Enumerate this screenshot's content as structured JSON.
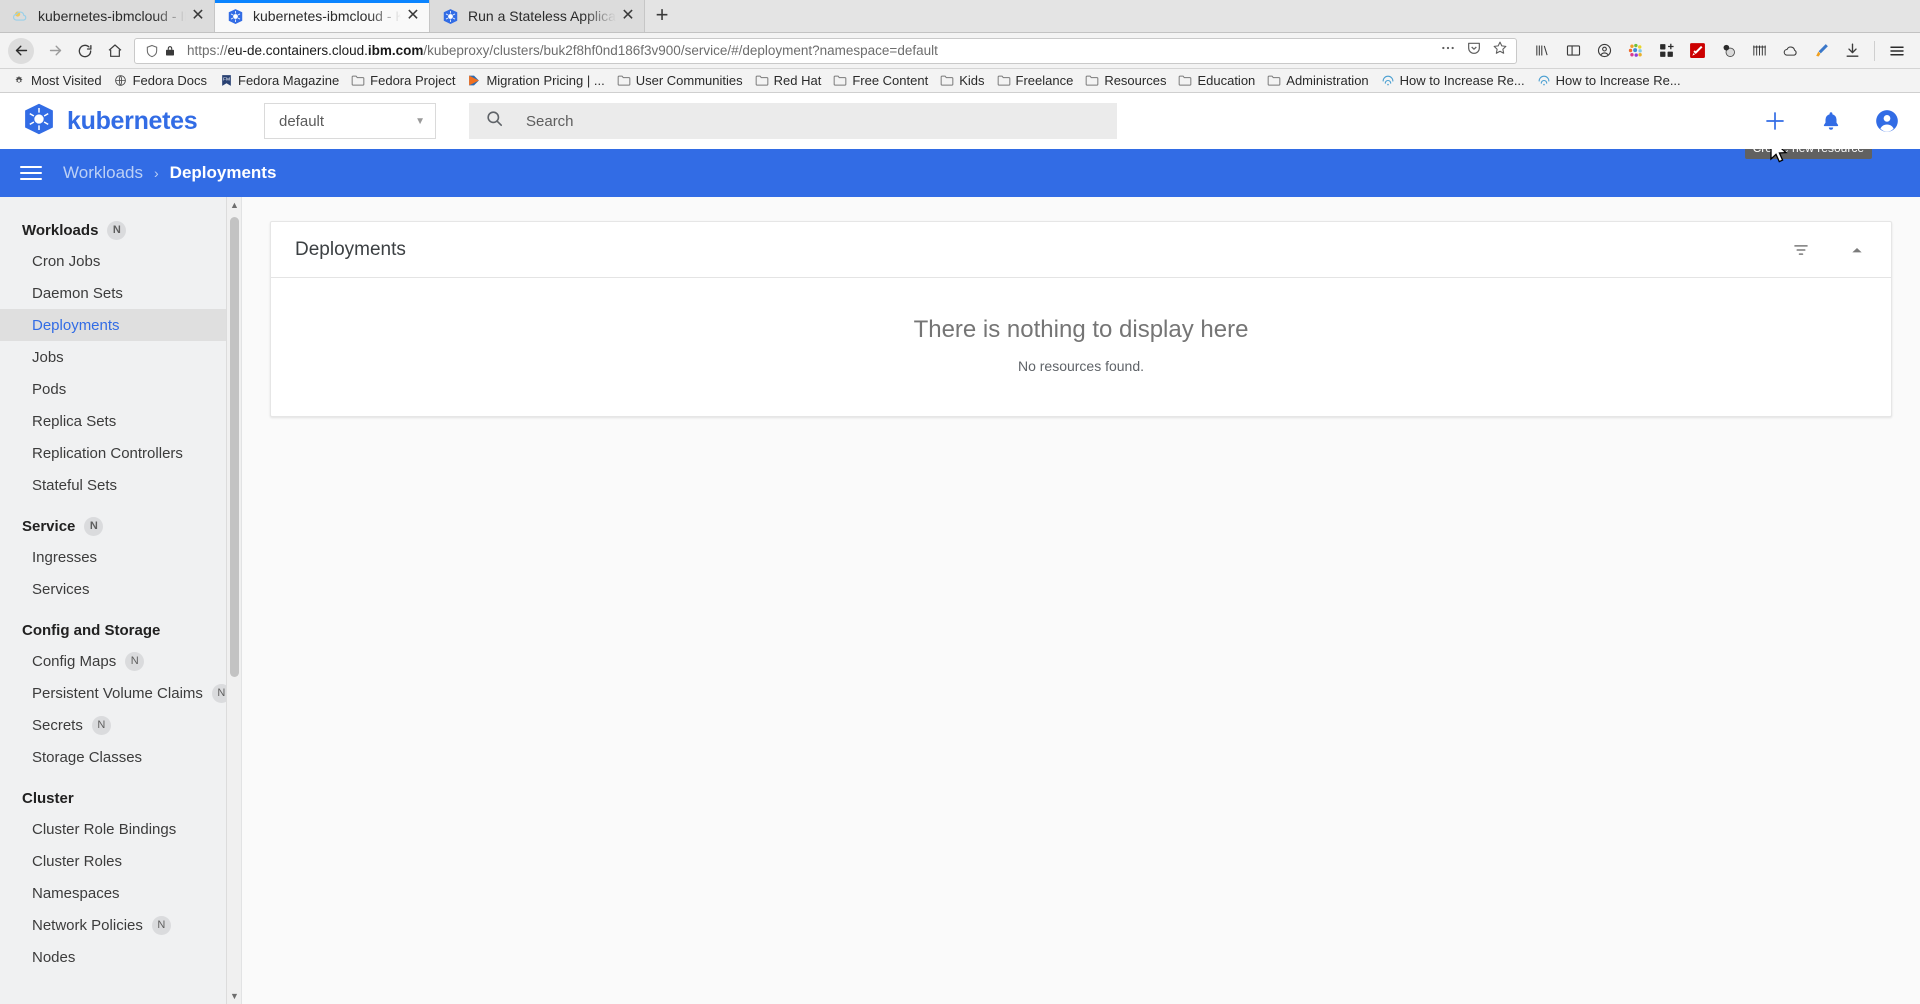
{
  "browser": {
    "tabs": [
      {
        "title": "kubernetes-ibmcloud - IB",
        "favicon": "cloud-icon",
        "active": false
      },
      {
        "title": "kubernetes-ibmcloud - K",
        "favicon": "kubernetes-icon",
        "active": true
      },
      {
        "title": "Run a Stateless Applicat",
        "favicon": "kubernetes-icon",
        "active": false
      }
    ],
    "new_tab_label": "+",
    "close_label": "✕",
    "nav": {
      "back_icon": "back-arrow-icon",
      "forward_icon": "forward-arrow-icon",
      "reload_icon": "reload-icon",
      "home_icon": "home-icon"
    },
    "url": {
      "scheme": "https://",
      "subdomain": "eu-de.containers.cloud.",
      "domain": "ibm.com",
      "path": "/kubeproxy/clusters/buk2f8hf0nd186f3v900/service/#/deployment?namespace=default",
      "full": "https://eu-de.containers.cloud.ibm.com/kubeproxy/clusters/buk2f8hf0nd186f3v900/service/#/deployment?namespace=default",
      "shield_icon": "tracking-protection-shield-icon",
      "lock_icon": "padlock-icon",
      "more_icon": "page-actions-ellipsis-icon",
      "pocket_icon": "save-to-pocket-icon",
      "bookmark_icon": "bookmark-star-icon"
    },
    "toolbar_icons": [
      "library-icon",
      "sidebar-icon",
      "account-circle-icon",
      "colorzilla-icon",
      "extension-grid-icon",
      "wappalyzer-icon",
      "molecule-icon",
      "ruler-icon",
      "cloud-icon",
      "highlighter-icon",
      "downloads-icon"
    ],
    "menu_icon": "hamburger-menu-icon",
    "bookmarks": [
      {
        "label": "Most Visited",
        "icon": "star-icon"
      },
      {
        "label": "Fedora Docs",
        "icon": "globe-icon"
      },
      {
        "label": "Fedora Magazine",
        "icon": "fm-icon"
      },
      {
        "label": "Fedora Project",
        "icon": "folder-icon"
      },
      {
        "label": "Migration Pricing | ...",
        "icon": "play-icon"
      },
      {
        "label": "User Communities",
        "icon": "folder-icon"
      },
      {
        "label": "Red Hat",
        "icon": "folder-icon"
      },
      {
        "label": "Free Content",
        "icon": "folder-icon"
      },
      {
        "label": "Kids",
        "icon": "folder-icon"
      },
      {
        "label": "Freelance",
        "icon": "folder-icon"
      },
      {
        "label": "Resources",
        "icon": "folder-icon"
      },
      {
        "label": "Education",
        "icon": "folder-icon"
      },
      {
        "label": "Administration",
        "icon": "folder-icon"
      },
      {
        "label": "How to Increase Re...",
        "icon": "rss-icon"
      },
      {
        "label": "How to Increase Re...",
        "icon": "rss-icon"
      }
    ]
  },
  "app": {
    "brand": "kubernetes",
    "brand_color": "#326ce5",
    "namespace_selected": "default",
    "search_placeholder": "Search",
    "header_icons": [
      {
        "name": "create-new-resource-icon",
        "glyph": "+"
      },
      {
        "name": "notifications-bell-icon",
        "glyph": "bell"
      },
      {
        "name": "user-account-icon",
        "glyph": "account"
      }
    ],
    "tooltip": "Create new resource",
    "breadcrumb": {
      "parent": "Workloads",
      "separator": "›",
      "current": "Deployments"
    }
  },
  "sidebar": {
    "groups": [
      {
        "title": "Workloads",
        "badge": "N",
        "items": [
          {
            "label": "Cron Jobs",
            "badge": "",
            "selected": false
          },
          {
            "label": "Daemon Sets",
            "badge": "",
            "selected": false
          },
          {
            "label": "Deployments",
            "badge": "",
            "selected": true
          },
          {
            "label": "Jobs",
            "badge": "",
            "selected": false
          },
          {
            "label": "Pods",
            "badge": "",
            "selected": false
          },
          {
            "label": "Replica Sets",
            "badge": "",
            "selected": false
          },
          {
            "label": "Replication Controllers",
            "badge": "",
            "selected": false
          },
          {
            "label": "Stateful Sets",
            "badge": "",
            "selected": false
          }
        ]
      },
      {
        "title": "Service",
        "badge": "N",
        "items": [
          {
            "label": "Ingresses",
            "badge": "",
            "selected": false
          },
          {
            "label": "Services",
            "badge": "",
            "selected": false
          }
        ]
      },
      {
        "title": "Config and Storage",
        "badge": "",
        "items": [
          {
            "label": "Config Maps",
            "badge": "N",
            "selected": false
          },
          {
            "label": "Persistent Volume Claims",
            "badge": "N",
            "selected": false
          },
          {
            "label": "Secrets",
            "badge": "N",
            "selected": false
          },
          {
            "label": "Storage Classes",
            "badge": "",
            "selected": false
          }
        ]
      },
      {
        "title": "Cluster",
        "badge": "",
        "items": [
          {
            "label": "Cluster Role Bindings",
            "badge": "",
            "selected": false
          },
          {
            "label": "Cluster Roles",
            "badge": "",
            "selected": false
          },
          {
            "label": "Namespaces",
            "badge": "",
            "selected": false
          },
          {
            "label": "Network Policies",
            "badge": "N",
            "selected": false
          },
          {
            "label": "Nodes",
            "badge": "",
            "selected": false
          }
        ]
      }
    ]
  },
  "main": {
    "card_title": "Deployments",
    "filter_icon": "filter-icon",
    "collapse_icon": "chevron-up-icon",
    "empty_title": "There is nothing to display here",
    "empty_subtitle": "No resources found."
  }
}
